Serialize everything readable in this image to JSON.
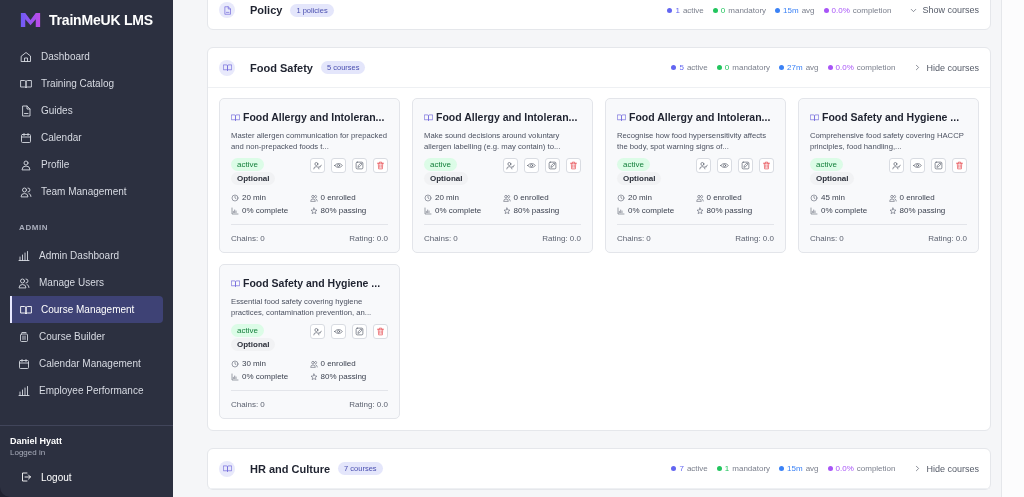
{
  "sidebar": {
    "brand": "TrainMeUK LMS",
    "items": [
      {
        "label": "Dashboard",
        "kind": "home",
        "selected": false
      },
      {
        "label": "Training Catalog",
        "kind": "book",
        "selected": false
      },
      {
        "label": "Guides",
        "kind": "doc",
        "selected": false
      },
      {
        "label": "Calendar",
        "kind": "calendar",
        "selected": false
      },
      {
        "label": "Profile",
        "kind": "user",
        "selected": false
      },
      {
        "label": "Team Management",
        "kind": "users",
        "selected": false
      }
    ],
    "admin_heading": "ADMIN",
    "admin_items": [
      {
        "label": "Admin Dashboard",
        "kind": "chart",
        "selected": false
      },
      {
        "label": "Manage Users",
        "kind": "users",
        "selected": false
      },
      {
        "label": "Course Management",
        "kind": "book",
        "selected": true
      },
      {
        "label": "Course Builder",
        "kind": "layers",
        "selected": false
      },
      {
        "label": "Calendar Management",
        "kind": "calendar",
        "selected": false
      },
      {
        "label": "Employee Performance",
        "kind": "chart",
        "selected": false
      }
    ],
    "user": {
      "name": "Daniel Hyatt",
      "status": "Logged in"
    },
    "logout": "Logout"
  },
  "sections": [
    {
      "title": "Policy",
      "kind": "doc",
      "count": "1 policies",
      "expanded": false,
      "toggle": "Show courses",
      "stats": [
        {
          "value": "1",
          "label": "active",
          "color": "#6366f1"
        },
        {
          "value": "0",
          "label": "mandatory",
          "color": "#22c55e"
        },
        {
          "value": "15m",
          "label": "avg",
          "color": "#3b82f6"
        },
        {
          "value": "0.0%",
          "label": "completion",
          "color": "#a855f7"
        }
      ]
    },
    {
      "title": "Food Safety",
      "kind": "book",
      "count": "5 courses",
      "expanded": true,
      "toggle": "Hide courses",
      "stats": [
        {
          "value": "5",
          "label": "active",
          "color": "#6366f1"
        },
        {
          "value": "0",
          "label": "mandatory",
          "color": "#22c55e"
        },
        {
          "value": "27m",
          "label": "avg",
          "color": "#3b82f6"
        },
        {
          "value": "0.0%",
          "label": "completion",
          "color": "#a855f7"
        }
      ],
      "courses": [
        {
          "title": "Food Allergy and Intoleran...",
          "description": "Master allergen communication for prepacked and non-prepacked foods t...",
          "status": "active",
          "requirement": "Optional",
          "duration": "20 min",
          "enrolled": "0 enrolled",
          "complete": "0% complete",
          "passing": "80% passing",
          "chains": "Chains: 0",
          "rating": "Rating: 0.0"
        },
        {
          "title": "Food Allergy and Intoleran...",
          "description": "Make sound decisions around voluntary allergen labelling (e.g. may contain) to...",
          "status": "active",
          "requirement": "Optional",
          "duration": "20 min",
          "enrolled": "0 enrolled",
          "complete": "0% complete",
          "passing": "80% passing",
          "chains": "Chains: 0",
          "rating": "Rating: 0.0"
        },
        {
          "title": "Food Allergy and Intoleran...",
          "description": "Recognise how food hypersensitivity affects the body, spot warning signs of...",
          "status": "active",
          "requirement": "Optional",
          "duration": "20 min",
          "enrolled": "0 enrolled",
          "complete": "0% complete",
          "passing": "80% passing",
          "chains": "Chains: 0",
          "rating": "Rating: 0.0"
        },
        {
          "title": "Food Safety and Hygiene ...",
          "description": "Comprehensive food safety covering HACCP principles, food handling,...",
          "status": "active",
          "requirement": "Optional",
          "duration": "45 min",
          "enrolled": "0 enrolled",
          "complete": "0% complete",
          "passing": "80% passing",
          "chains": "Chains: 0",
          "rating": "Rating: 0.0"
        },
        {
          "title": "Food Safety and Hygiene ...",
          "description": "Essential food safety covering hygiene practices, contamination prevention, an...",
          "status": "active",
          "requirement": "Optional",
          "duration": "30 min",
          "enrolled": "0 enrolled",
          "complete": "0% complete",
          "passing": "80% passing",
          "chains": "Chains: 0",
          "rating": "Rating: 0.0"
        }
      ]
    },
    {
      "title": "HR and Culture",
      "kind": "book",
      "count": "7 courses",
      "expanded": true,
      "toggle": "Hide courses",
      "stats": [
        {
          "value": "7",
          "label": "active",
          "color": "#6366f1"
        },
        {
          "value": "1",
          "label": "mandatory",
          "color": "#22c55e"
        },
        {
          "value": "15m",
          "label": "avg",
          "color": "#3b82f6"
        },
        {
          "value": "0.0%",
          "label": "completion",
          "color": "#a855f7"
        }
      ]
    }
  ]
}
